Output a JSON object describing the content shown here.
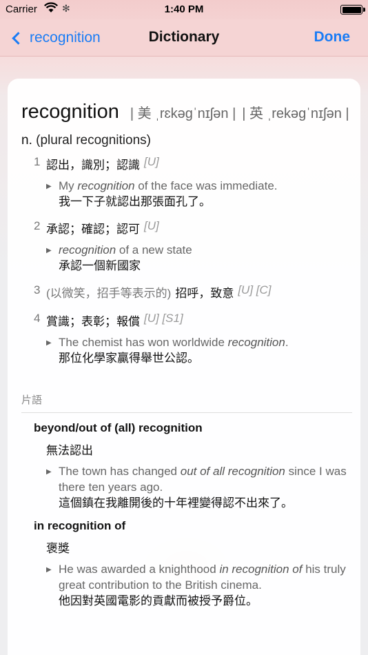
{
  "status_bar": {
    "carrier": "Carrier",
    "time": "1:40 PM"
  },
  "nav": {
    "back_label": "recognition",
    "title": "Dictionary",
    "done_label": "Done"
  },
  "entry": {
    "headword": "recognition",
    "pron_us": "| 美 ˌrɛkəɡˈnɪʃən |",
    "pron_uk": "| 英 ˌrekəɡˈnɪʃən |",
    "pos": "n.",
    "plural_note": "(plural recognitions)",
    "senses": [
      {
        "num": "1",
        "label": "",
        "definition": "認出，識別；認識",
        "grammar": "[U]",
        "example_pre": "My ",
        "example_em": "recognition",
        "example_post": " of the face was immediate.",
        "example_zh": "我一下子就認出那張面孔了。"
      },
      {
        "num": "2",
        "label": "",
        "definition": "承認；確認；認可",
        "grammar": "[U]",
        "example_pre": "",
        "example_em": "recognition",
        "example_post": " of a new state",
        "example_zh": "承認一個新國家"
      },
      {
        "num": "3",
        "label": "(以微笑，招手等表示的)",
        "definition": "招呼，致意",
        "grammar": "[U] [C]"
      },
      {
        "num": "4",
        "label": "",
        "definition": "賞識；表彰；報償",
        "grammar": "[U] [S1]",
        "example_pre": "The chemist has won worldwide ",
        "example_em": "recognition",
        "example_post": ".",
        "example_zh": "那位化學家贏得舉世公認。"
      }
    ],
    "phrases_label": "片語",
    "phrases": [
      {
        "title": "beyond/out of (all) recognition",
        "definition": "無法認出",
        "example_pre": "The town has changed ",
        "example_em": "out of all recognition",
        "example_post": " since I was there ten years ago.",
        "example_zh": "這個鎮在我離開後的十年裡變得認不出來了。"
      },
      {
        "title": "in recognition of",
        "definition": "褒獎",
        "example_pre": "He was awarded a knighthood ",
        "example_em": "in recognition of",
        "example_post": " his truly great contribution to the British cinema.",
        "example_zh": "他因對英國電影的貢獻而被授予爵位。"
      }
    ]
  }
}
